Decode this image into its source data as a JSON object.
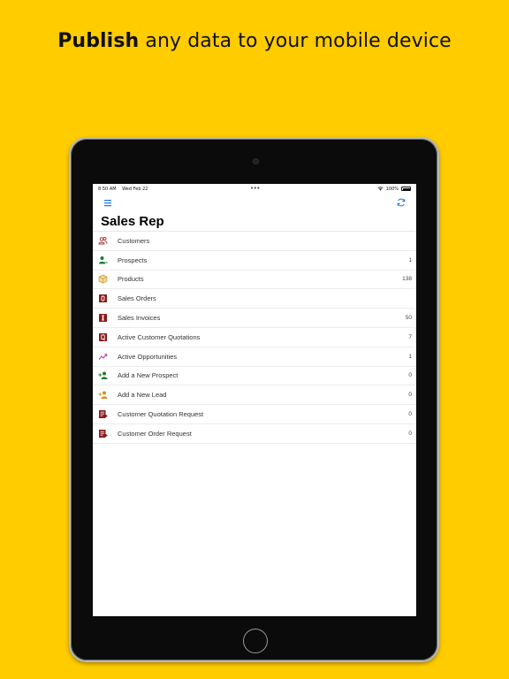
{
  "headline": {
    "bold": "Publish",
    "rest": " any data to your mobile device"
  },
  "status_bar": {
    "time": "8:50 AM",
    "date": "Wed Feb 22",
    "battery": "100%"
  },
  "app": {
    "title": "Sales Rep",
    "items": [
      {
        "label": "Customers",
        "count": "",
        "icon": "customers-icon"
      },
      {
        "label": "Prospects",
        "count": "1",
        "icon": "prospect-icon"
      },
      {
        "label": "Products",
        "count": "138",
        "icon": "product-box-icon"
      },
      {
        "label": "Sales Orders",
        "count": "",
        "icon": "sales-order-icon"
      },
      {
        "label": "Sales Invoices",
        "count": "50",
        "icon": "invoice-icon"
      },
      {
        "label": "Active Customer Quotations",
        "count": "7",
        "icon": "quotation-icon"
      },
      {
        "label": "Active Opportunities",
        "count": "1",
        "icon": "trend-icon"
      },
      {
        "label": "Add a New Prospect",
        "count": "0",
        "icon": "add-prospect-icon"
      },
      {
        "label": "Add a New Lead",
        "count": "0",
        "icon": "add-lead-icon"
      },
      {
        "label": "Customer Quotation Request",
        "count": "0",
        "icon": "quotation-request-icon"
      },
      {
        "label": "Customer Order Request",
        "count": "0",
        "icon": "order-request-icon"
      }
    ]
  },
  "colors": {
    "background": "#FFCC00",
    "accent": "#1a73e8",
    "dark_red": "#8b1a1a",
    "green": "#1e7b34",
    "orange": "#e0891b",
    "purple": "#b03aa6"
  }
}
